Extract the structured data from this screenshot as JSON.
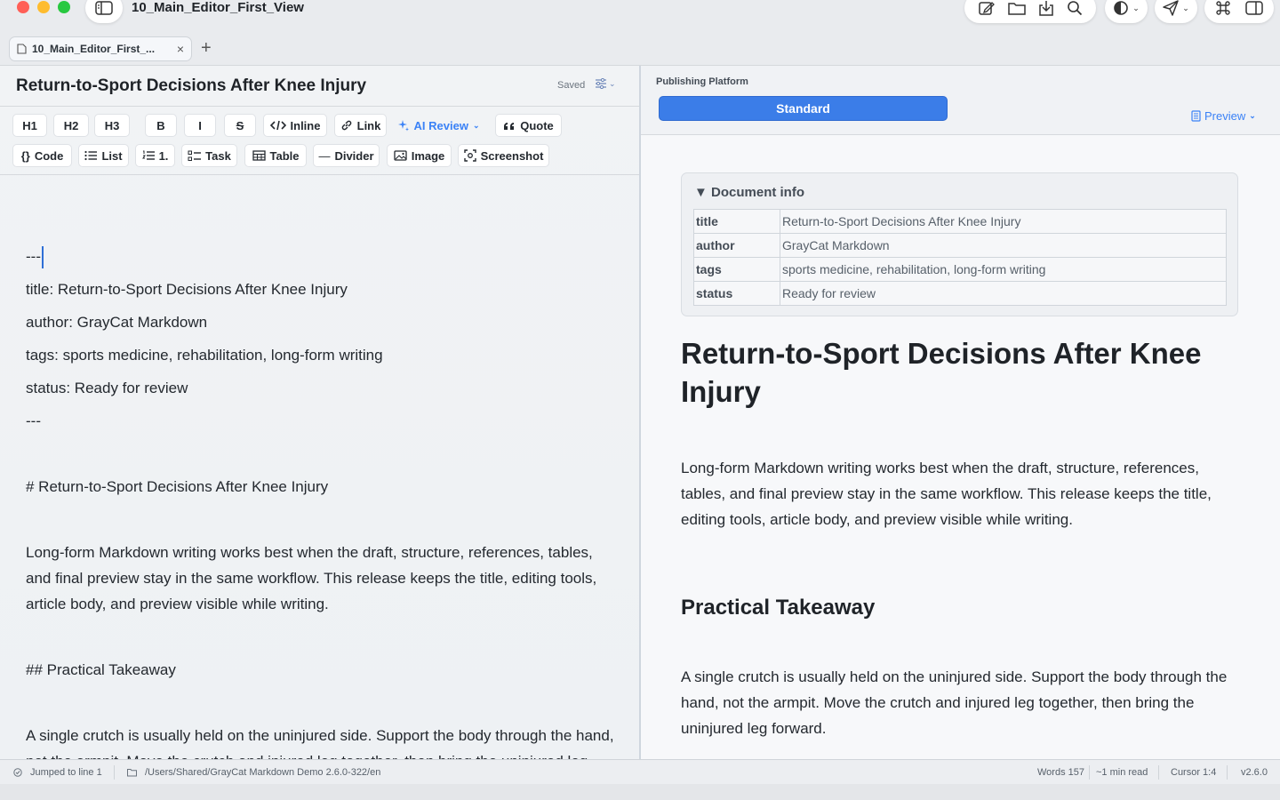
{
  "window": {
    "title": "10_Main_Editor_First_View"
  },
  "tabs": [
    {
      "label": "10_Main_Editor_First_...",
      "close": "×"
    }
  ],
  "tab_add": "+",
  "editor": {
    "doc_title": "Return-to-Sport Decisions After Knee Injury",
    "saved": "Saved",
    "toolbar": {
      "h1": "H1",
      "h2": "H2",
      "h3": "H3",
      "bold": "B",
      "italic": "I",
      "strike": "S",
      "inline": "Inline",
      "link": "Link",
      "ai_review": "AI Review",
      "quote": "Quote",
      "code": "Code",
      "list": "List",
      "ordered": "1.",
      "task": "Task",
      "table": "Table",
      "divider": "Divider",
      "image": "Image",
      "screenshot": "Screenshot"
    },
    "lines": {
      "fm_open": "---",
      "fm_title": "title: Return-to-Sport Decisions After Knee Injury",
      "fm_author": "author: GrayCat Markdown",
      "fm_tags": "tags: sports medicine, rehabilitation, long-form writing",
      "fm_status": "status: Ready for review",
      "fm_close": "---",
      "h1": "# Return-to-Sport Decisions After Knee Injury",
      "para1": "Long-form Markdown writing works best when the draft, structure, references, tables, and final preview stay in the same workflow. This release keeps the title, editing tools, article body, and preview visible while writing.",
      "h2": "## Practical Takeaway",
      "para2": "A single crutch is usually held on the uninjured side. Support the body through the hand, not the armpit. Move the crutch and injured leg together, then bring the uninjured leg forward."
    }
  },
  "preview": {
    "platform_label": "Publishing Platform",
    "platform_value": "Standard",
    "preview_label": "Preview",
    "docinfo": {
      "summary": "▼ Document info",
      "rows": [
        {
          "key": "title",
          "value": "Return-to-Sport Decisions After Knee Injury"
        },
        {
          "key": "author",
          "value": "GrayCat Markdown"
        },
        {
          "key": "tags",
          "value": "sports medicine, rehabilitation, long-form writing"
        },
        {
          "key": "status",
          "value": "Ready for review"
        }
      ]
    },
    "h1": "Return-to-Sport Decisions After Knee Injury",
    "para1": "Long-form Markdown writing works best when the draft, structure, references, tables, and final preview stay in the same workflow. This release keeps the title, editing tools, article body, and preview visible while writing.",
    "h2": "Practical Takeaway",
    "para2": "A single crutch is usually held on the uninjured side. Support the body through the hand, not the armpit. Move the crutch and injured leg together, then bring the uninjured leg forward."
  },
  "status": {
    "message": "Jumped to line 1",
    "path": "/Users/Shared/GrayCat Markdown Demo 2.6.0-322/en",
    "words": "Words 157",
    "read_time": "~1 min read",
    "cursor": "Cursor 1:4",
    "version": "v2.6.0"
  },
  "colors": {
    "accent": "#3b7de8",
    "ai_accent": "#3b82f6",
    "text": "#1f2328",
    "muted": "#6a737d"
  }
}
